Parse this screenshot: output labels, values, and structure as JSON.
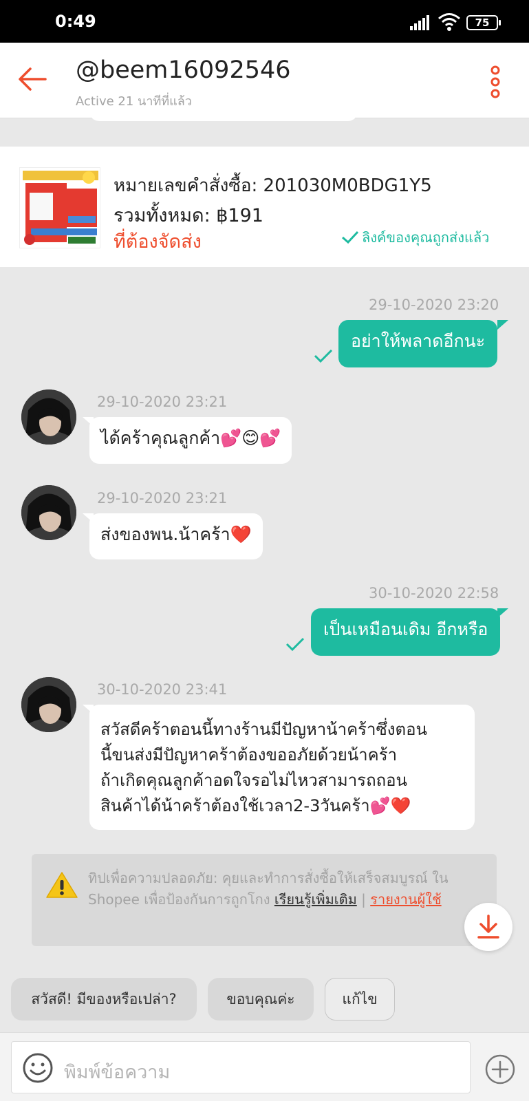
{
  "status_bar": {
    "time": "0:49",
    "battery": "75"
  },
  "header": {
    "title": "@beem16092546",
    "subtitle": "Active 21 นาทีที่แล้ว"
  },
  "order": {
    "order_number": "หมายเลขคำสั่งซื้อ: 201030M0BDG1Y5",
    "total": "รวมทั้งหมด: ฿191",
    "status": "ที่ต้องจัดส่ง",
    "link_status": "ลิงค์ของคุณถูกส่งแล้ว"
  },
  "messages": [
    {
      "direction": "sent",
      "timestamp": "29-10-2020 23:20",
      "text": "อย่าให้พลาดอีกนะ"
    },
    {
      "direction": "received",
      "timestamp": "29-10-2020 23:21",
      "text": "ได้คร้าคุณลูกค้า💕😊💕"
    },
    {
      "direction": "received",
      "timestamp": "29-10-2020 23:21",
      "text": "ส่งของพน.น้าคร้า❤️"
    },
    {
      "direction": "sent",
      "timestamp": "30-10-2020 22:58",
      "text": "เป็นเหมือนเดิม อีกหรือ"
    },
    {
      "direction": "received",
      "timestamp": "30-10-2020 23:41",
      "lines": [
        "สวัสดีคร้าตอนนี้ทางร้านมีปัญหาน้าคร้าซึ่งตอน",
        "นี้ขนส่งมีปัญหาคร้าต้องขออภัยด้วยน้าคร้า",
        "ถ้าเกิดคุณลูกค้าอดใจรอไม่ไหวสามารถถอน",
        "สินค้าได้น้าคร้าต้องใช้เวลา2-3วันคร้า💕❤️"
      ]
    }
  ],
  "tip": {
    "prefix": "ทิปเพื่อความปลอดภัย: คุยและทำการสั่งซื้อให้เสร็จสมบูรณ์ ใน Shopee เพื่อป้องกันการถูกโกง ",
    "learn_more": "เรียนรู้เพิ่มเติม",
    "separator": " | ",
    "report": "รายงานผู้ใช้"
  },
  "quick_replies": [
    "สวัสดี! มีของหรือเปล่า?",
    "ขอบคุณค่ะ",
    "แก้ไข"
  ],
  "input": {
    "placeholder": "พิมพ์ข้อความ"
  },
  "colors": {
    "accent": "#ee4d2d",
    "sent_bubble": "#1ebba0",
    "background": "#e8e8e8"
  },
  "icons": [
    "back-arrow-icon",
    "more-vert-icon",
    "warning-icon",
    "download-arrow-icon",
    "emoji-icon",
    "plus-circle-icon",
    "check-icon"
  ]
}
